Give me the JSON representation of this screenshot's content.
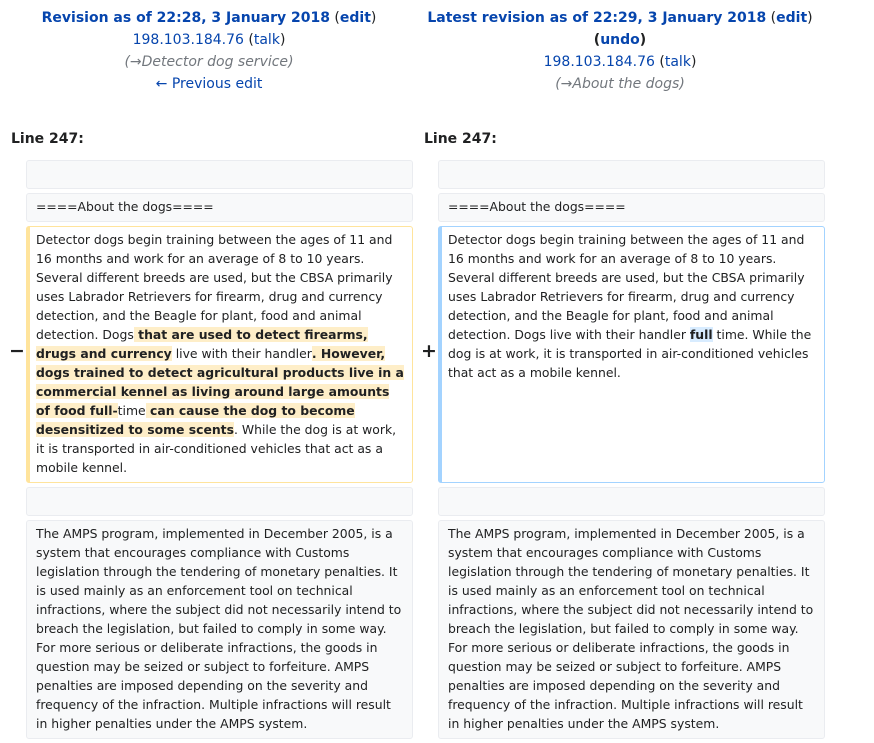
{
  "left_header": {
    "title_prefix": "Revision as of 22:28, 3 January 2018",
    "paren_open": " (",
    "edit_link": "edit",
    "paren_close": ")",
    "user": "198.103.184.76",
    "talk_open": " (",
    "talk_link": "talk",
    "talk_close": ")",
    "comment_open": "(",
    "comment_arrow": "→",
    "comment_text": "Detector dog service",
    "comment_close": ")",
    "nav_link": "← Previous edit"
  },
  "right_header": {
    "title_prefix": "Latest revision as of 22:29, 3 January 2018",
    "paren_open": " (",
    "edit_link": "edit",
    "paren_close": ")",
    "undo_open": "(",
    "undo_link": "undo",
    "undo_close": ")",
    "user": "198.103.184.76",
    "talk_open": " (",
    "talk_link": "talk",
    "talk_close": ")",
    "comment_open": "(",
    "comment_arrow": "→",
    "comment_text": "About the dogs",
    "comment_close": ")"
  },
  "line_left": "Line 247:",
  "line_right": "Line 247:",
  "heading_text": "====About the dogs====",
  "markers": {
    "minus": "−",
    "plus": "+"
  },
  "deleted_paragraph": {
    "p1": "Detector dogs begin training between the ages of 11 and 16 months and work for an average of 8 to 10 years. Several different breeds are used, but the CBSA primarily uses Labrador Retrievers for firearm, drug and currency detection, and the Beagle for plant, food and animal detection. Dogs",
    "c1": " that are used to detect firearms, drugs and currency",
    "p2": " live with their handler",
    "c2": ". However, dogs trained to detect agricultural products live in a commercial kennel as living around large amounts of food full-",
    "p3": "time",
    "c3": " can cause the dog to become desensitized to some scents",
    "p4": ". While the dog is at work, it is transported in air-conditioned vehicles that act as a mobile kennel."
  },
  "added_paragraph": {
    "p1": "Detector dogs begin training between the ages of 11 and 16 months and work for an average of 8 to 10 years. Several different breeds are used, but the CBSA primarily uses Labrador Retrievers for firearm, drug and currency detection, and the Beagle for plant, food and animal detection. Dogs live with their handler ",
    "c1": "full",
    "p2": " time. While the dog is at work, it is transported in air-conditioned vehicles that act as a mobile kennel."
  },
  "amps_paragraph": "The AMPS program, implemented in December 2005, is a system that encourages compliance with Customs legislation through the tendering of monetary penalties. It is used mainly as an enforcement tool on technical infractions, where the subject did not necessarily intend to breach the legislation, but failed to comply in some way. For more serious or deliberate infractions, the goods in question may be seized or subject to forfeiture. AMPS penalties are imposed depending on the severity and frequency of the infraction. Multiple infractions will result in higher penalties under the AMPS system."
}
